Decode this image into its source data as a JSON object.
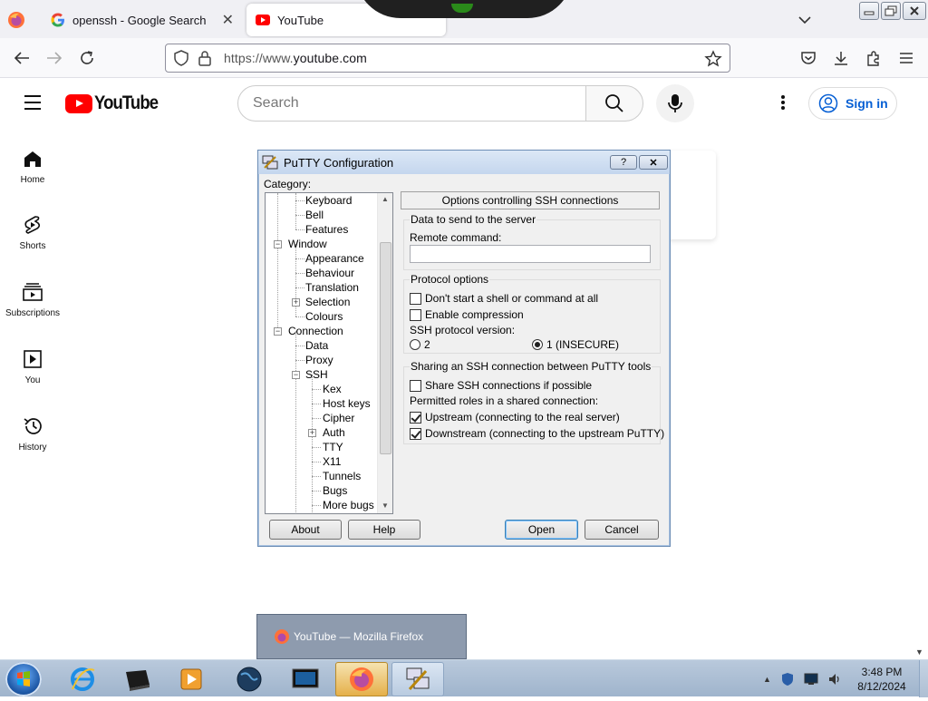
{
  "browser": {
    "tabs": [
      {
        "title": "openssh - Google Search",
        "close": "✕"
      },
      {
        "title": "YouTube",
        "close": ""
      }
    ],
    "url_prefix": "https://www.",
    "url_domain": "youtube.com"
  },
  "youtube": {
    "logo_text": "YouTube",
    "search_placeholder": "Search",
    "signin_label": "Sign in",
    "sidebar": [
      {
        "label": "Home",
        "icon": "home-icon"
      },
      {
        "label": "Shorts",
        "icon": "shorts-icon"
      },
      {
        "label": "Subscriptions",
        "icon": "subscriptions-icon"
      },
      {
        "label": "You",
        "icon": "you-icon"
      },
      {
        "label": "History",
        "icon": "history-icon"
      }
    ]
  },
  "putty": {
    "title": "PuTTY Configuration",
    "help_btn": "?",
    "close_btn": "✕",
    "category_label": "Category:",
    "tree": [
      {
        "label": "Keyboard"
      },
      {
        "label": "Bell"
      },
      {
        "label": "Features"
      },
      {
        "label": "Window"
      },
      {
        "label": "Appearance"
      },
      {
        "label": "Behaviour"
      },
      {
        "label": "Translation"
      },
      {
        "label": "Selection"
      },
      {
        "label": "Colours"
      },
      {
        "label": "Connection"
      },
      {
        "label": "Data"
      },
      {
        "label": "Proxy"
      },
      {
        "label": "SSH"
      },
      {
        "label": "Kex"
      },
      {
        "label": "Host keys"
      },
      {
        "label": "Cipher"
      },
      {
        "label": "Auth"
      },
      {
        "label": "TTY"
      },
      {
        "label": "X11"
      },
      {
        "label": "Tunnels"
      },
      {
        "label": "Bugs"
      },
      {
        "label": "More bugs"
      }
    ],
    "panel_title": "Options controlling SSH connections",
    "data_group": {
      "title": "Data to send to the server",
      "remote_label": "Remote command:",
      "remote_value": ""
    },
    "protocol_group": {
      "title": "Protocol options",
      "no_shell": {
        "label": "Don't start a shell or command at all",
        "checked": false
      },
      "compression": {
        "label": "Enable compression",
        "checked": false
      },
      "version_label": "SSH protocol version:",
      "v2": {
        "label": "2",
        "selected": false
      },
      "v1": {
        "label": "1 (INSECURE)",
        "selected": true
      }
    },
    "sharing_group": {
      "title": "Sharing an SSH connection between PuTTY tools",
      "share": {
        "label": "Share SSH connections if possible",
        "checked": false
      },
      "roles_label": "Permitted roles in a shared connection:",
      "upstream": {
        "label": "Upstream (connecting to the real server)",
        "checked": true
      },
      "downstream": {
        "label": "Downstream (connecting to the upstream PuTTY)",
        "checked": true
      }
    },
    "buttons": {
      "about": "About",
      "help": "Help",
      "open": "Open",
      "cancel": "Cancel"
    }
  },
  "taskbar": {
    "preview_title": "YouTube — Mozilla Firefox",
    "time": "3:48 PM",
    "date": "8/12/2024"
  }
}
